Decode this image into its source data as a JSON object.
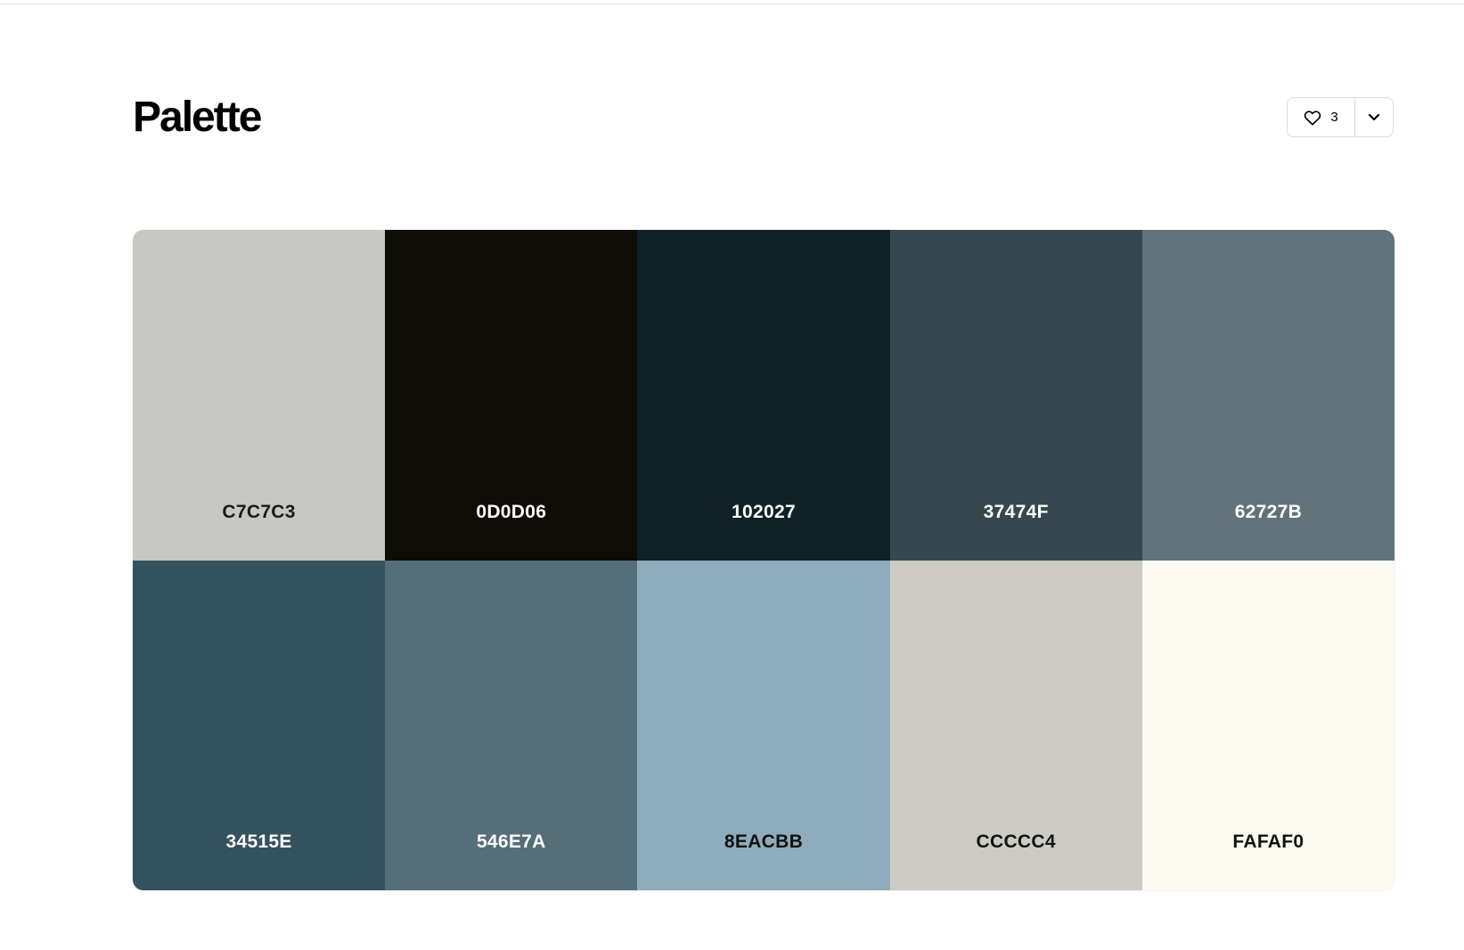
{
  "header": {
    "title": "Palette",
    "likes": "3"
  },
  "colors": [
    {
      "code": "C7C7C3",
      "bg": "#C7C7C3",
      "text": "#1a1a1a"
    },
    {
      "code": "0D0D06",
      "bg": "#0D0D06",
      "text": "#ffffff"
    },
    {
      "code": "102027",
      "bg": "#102027",
      "text": "#ffffff"
    },
    {
      "code": "37474F",
      "bg": "#37474F",
      "text": "#ffffff"
    },
    {
      "code": "62727B",
      "bg": "#62727B",
      "text": "#ffffff"
    },
    {
      "code": "34515E",
      "bg": "#34515E",
      "text": "#ffffff"
    },
    {
      "code": "546E7A",
      "bg": "#546E7A",
      "text": "#ffffff"
    },
    {
      "code": "8EACBB",
      "bg": "#8EACBB",
      "text": "#111111"
    },
    {
      "code": "CCCCC4",
      "bg": "#CCCCC4",
      "text": "#111111"
    },
    {
      "code": "FAFAF0",
      "bg": "#FAFAF0",
      "text": "#111111"
    }
  ],
  "icons": {
    "like": "heart-icon",
    "menu": "chevron-down-icon"
  }
}
